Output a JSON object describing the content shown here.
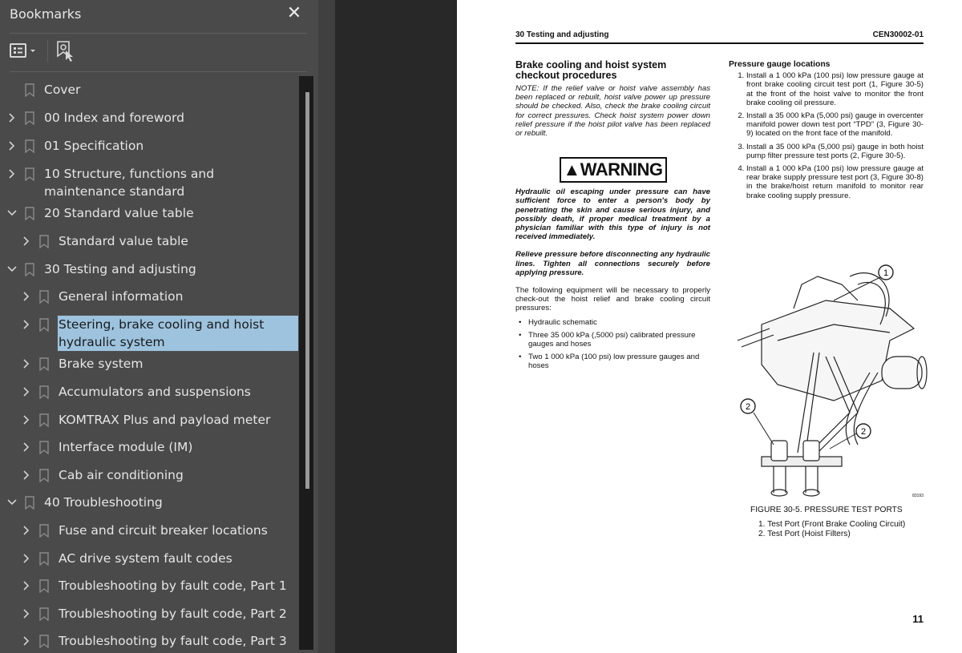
{
  "sidebar": {
    "title": "Bookmarks",
    "close_icon": "close-icon",
    "toolbar": {
      "options_icon": "list-options-icon",
      "find_icon": "find-current-bookmark-icon"
    },
    "items": [
      {
        "label": "Cover",
        "level": 0,
        "expander": "none"
      },
      {
        "label": "00 Index and foreword",
        "level": 0,
        "expander": "collapsed"
      },
      {
        "label": "01 Specification",
        "level": 0,
        "expander": "collapsed"
      },
      {
        "label": "10 Structure, functions and maintenance standard",
        "level": 0,
        "expander": "collapsed"
      },
      {
        "label": "20 Standard value table",
        "level": 0,
        "expander": "expanded"
      },
      {
        "label": "Standard value table",
        "level": 1,
        "expander": "collapsed"
      },
      {
        "label": "30 Testing and adjusting",
        "level": 0,
        "expander": "expanded"
      },
      {
        "label": "General information",
        "level": 1,
        "expander": "collapsed"
      },
      {
        "label": "Steering, brake cooling and hoist hydraulic system",
        "level": 1,
        "expander": "collapsed",
        "selected": true
      },
      {
        "label": "Brake system",
        "level": 1,
        "expander": "collapsed"
      },
      {
        "label": "Accumulators and suspensions",
        "level": 1,
        "expander": "collapsed"
      },
      {
        "label": "KOMTRAX Plus and payload meter",
        "level": 1,
        "expander": "collapsed"
      },
      {
        "label": "Interface module (IM)",
        "level": 1,
        "expander": "collapsed"
      },
      {
        "label": "Cab air conditioning",
        "level": 1,
        "expander": "collapsed"
      },
      {
        "label": "40 Troubleshooting",
        "level": 0,
        "expander": "expanded"
      },
      {
        "label": "Fuse and circuit breaker locations",
        "level": 1,
        "expander": "collapsed"
      },
      {
        "label": "AC drive system fault codes",
        "level": 1,
        "expander": "collapsed"
      },
      {
        "label": "Troubleshooting by fault code, Part 1",
        "level": 1,
        "expander": "collapsed"
      },
      {
        "label": "Troubleshooting by fault code, Part 2",
        "level": 1,
        "expander": "collapsed"
      },
      {
        "label": "Troubleshooting by fault code, Part 3",
        "level": 1,
        "expander": "collapsed"
      }
    ],
    "selected_color": "#9dc3de"
  },
  "page": {
    "header_left": "30 Testing and adjusting",
    "header_right": "CEN30002-01",
    "section_title": "Brake cooling and hoist system checkout procedures",
    "note": "NOTE: If the relief valve or hoist valve assembly has been replaced or rebuilt, hoist valve power up pressure should be checked. Also, check the brake cooling circuit for correct pressures. Check hoist system power down relief pressure if the hoist pilot valve has been replaced or rebuilt.",
    "warning_label": "WARNING",
    "warning_text": "Hydraulic oil escaping under pressure can have sufficient force to enter a person's body by penetrating the skin and cause serious injury, and possibly death, if proper medical treatment by a physician familiar with this type of injury is not received immediately.",
    "warning_text2": "Relieve pressure before disconnecting any hydraulic lines. Tighten all connections securely before applying pressure.",
    "equipment_intro": "The following equipment will be necessary to properly check-out the hoist relief and brake cooling circuit pressures:",
    "equipment": [
      "Hydraulic schematic",
      "Three 35 000 kPa (,5000 psi) calibrated pressure gauges and hoses",
      "Two 1 000 kPa (100 psi) low pressure gauges and hoses"
    ],
    "gauge_title": "Pressure gauge locations",
    "steps": [
      "Install a 1 000 kPa (100 psi) low pressure gauge at front brake cooling circuit test port (1, Figure 30-5) at the front of the hoist valve to monitor the front brake cooling oil pressure.",
      "Install a 35 000 kPa (5,000 psi) gauge in overcenter manifold power down test port “TPD” (3, Figure 30-9) located on the front face of the manifold.",
      "Install a 35 000 kPa (5,000 psi) gauge in both hoist pump filter pressure test ports (2, Figure 30-5).",
      "Install a 1 000 kPa (100 psi) low pressure gauge at rear brake supply pressure test port (3, Figure 30-8) in the brake/hoist return manifold to monitor rear brake cooling supply pressure."
    ],
    "figure": {
      "callouts": [
        "1",
        "2",
        "2"
      ],
      "code": "83193",
      "caption": "FIGURE 30-5. PRESSURE TEST PORTS",
      "items": [
        "1. Test Port (Front Brake Cooling Circuit)",
        "2. Test Port (Hoist Filters)"
      ]
    },
    "page_number": "11"
  }
}
